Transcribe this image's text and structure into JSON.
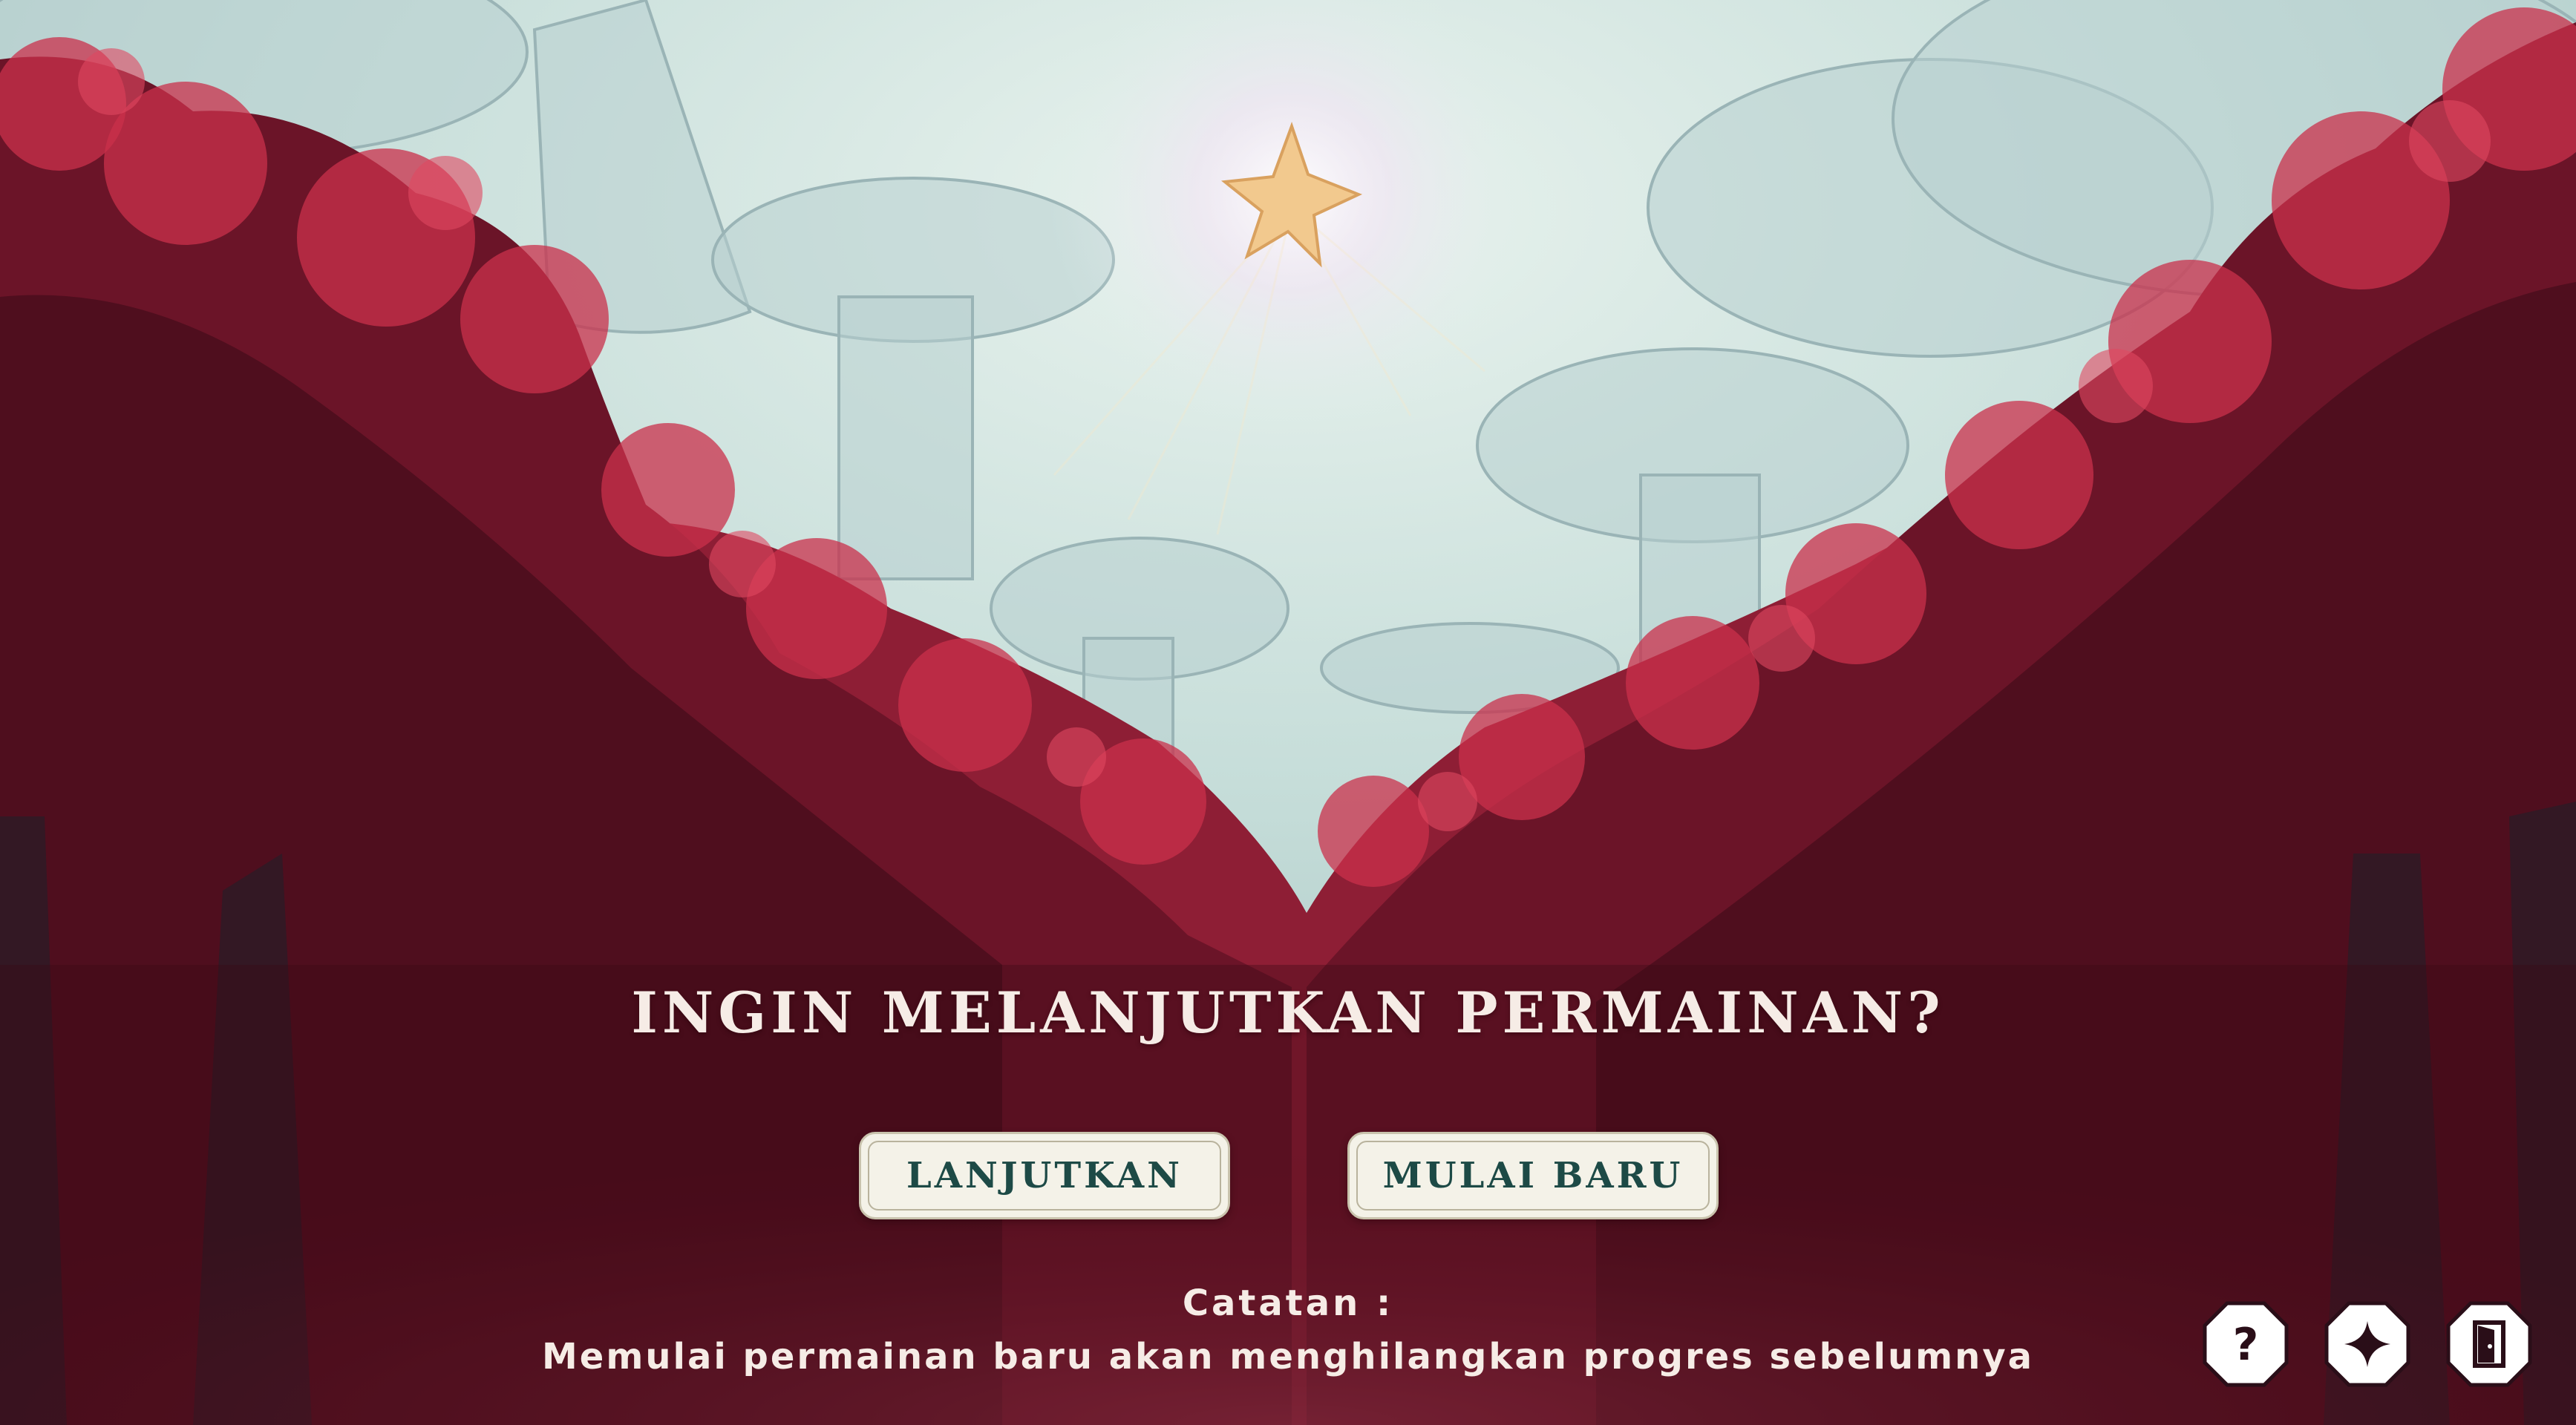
{
  "dialog": {
    "question": "INGIN MELANJUTKAN PERMAINAN?",
    "continue_label": "LANJUTKAN",
    "new_game_label": "MULAI BARU",
    "note_title": "Catatan :",
    "note_text": "Memulai permainan baru akan menghilangkan progres sebelumnya"
  },
  "corner_buttons": [
    {
      "name": "help-icon",
      "glyph": "?"
    },
    {
      "name": "sparkle-icon",
      "glyph": "✦"
    },
    {
      "name": "exit-door-icon",
      "glyph": "door"
    }
  ],
  "colors": {
    "sky": "#cfe3df",
    "foliage_dark": "#4a0f1c",
    "foliage_light": "#d2344e",
    "button_bg": "#f4f2e8",
    "button_text": "#1d4a46",
    "text_light": "#f6ece6"
  }
}
